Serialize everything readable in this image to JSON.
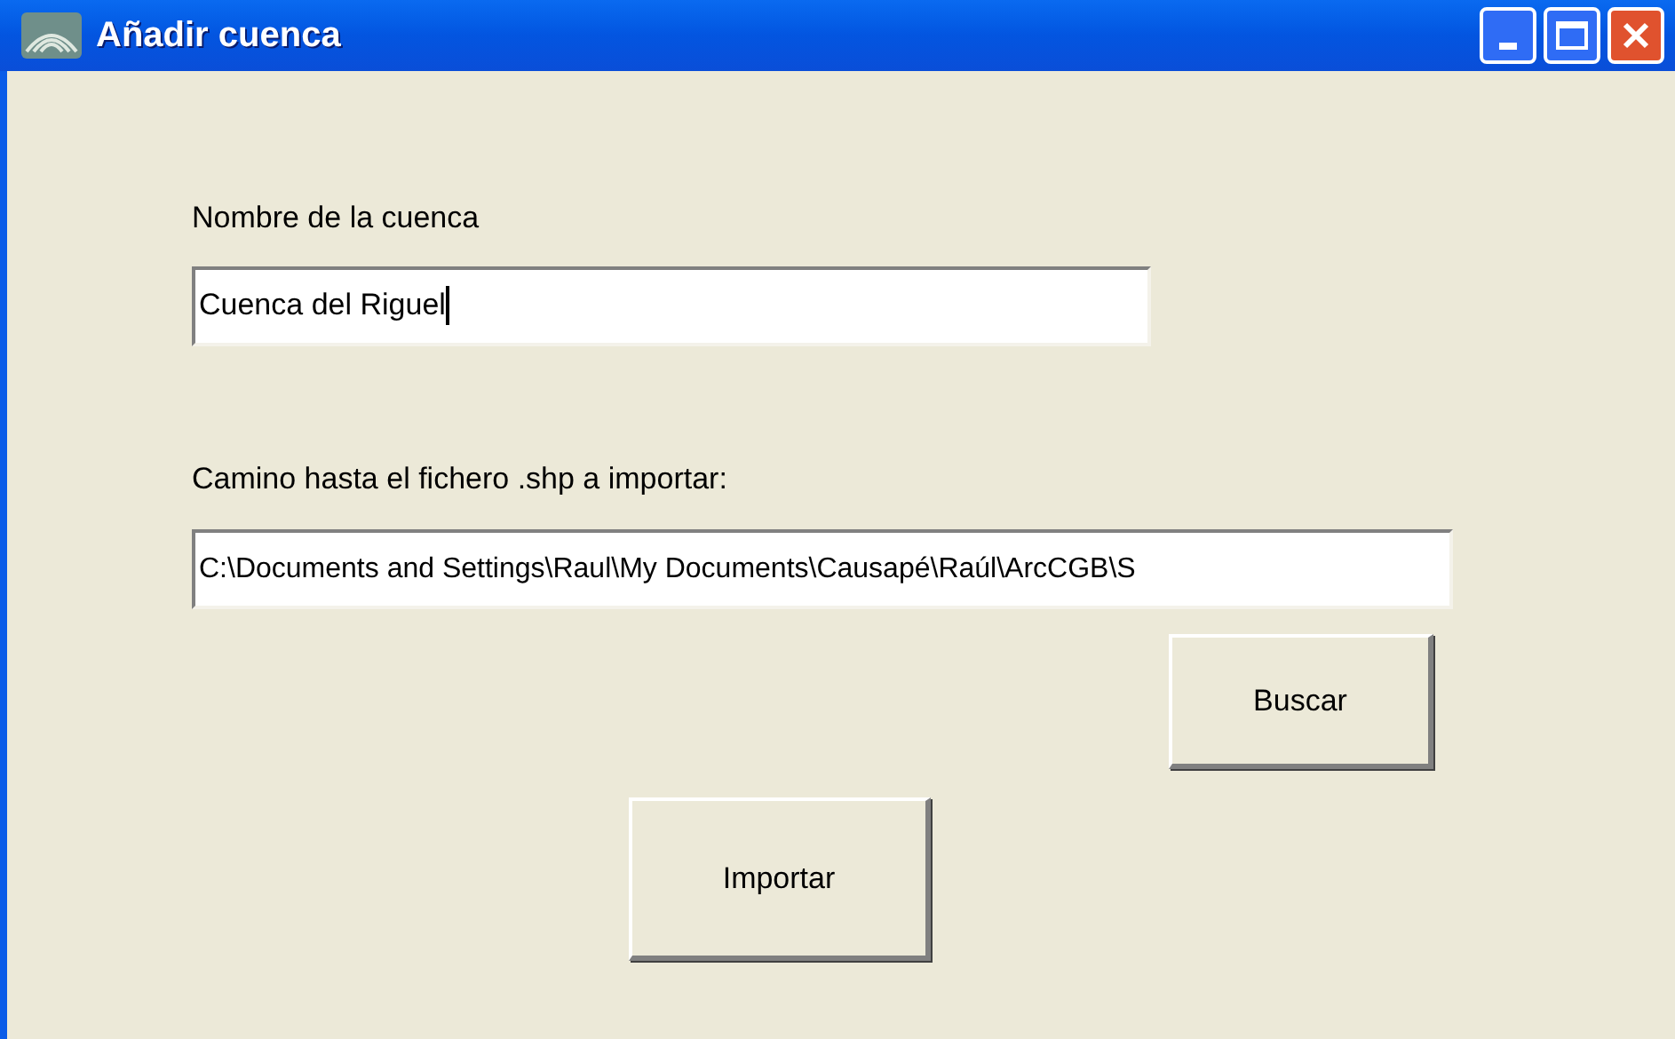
{
  "window": {
    "title": "Añadir cuenca"
  },
  "name_label": "Nombre de la cuenca",
  "name_field": {
    "value": "Cuenca del Riguel",
    "focused": true
  },
  "path_label": "Camino hasta el fichero .shp a importar:",
  "path_field": {
    "value": "C:\\Documents and Settings\\Raul\\My Documents\\Causapé\\Raúl\\ArcCGB\\S"
  },
  "buttons": [
    {
      "label": "Buscar",
      "kind": "browse"
    },
    {
      "label": "Importar",
      "kind": "import"
    }
  ]
}
